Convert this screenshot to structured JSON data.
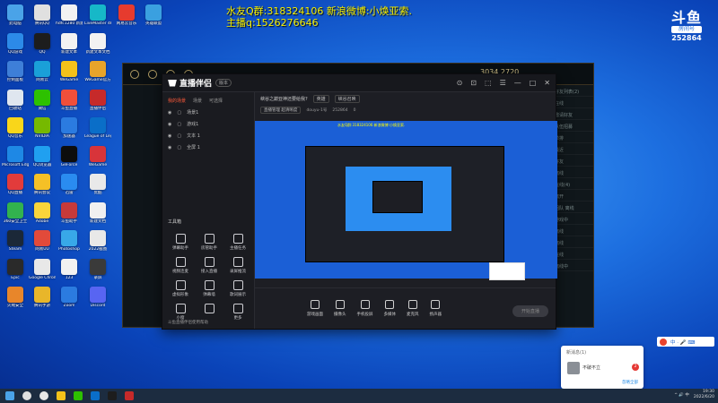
{
  "overlay": {
    "line1": "水友Q群:318324106 新浪微博:小焕亚索.",
    "line2": "主播q:1526276646"
  },
  "douyu": {
    "logo": "斗鱼",
    "sub": "房间号",
    "room": "252864"
  },
  "desktop_icons": [
    {
      "label": "此电脑",
      "color": "#4aa3e8",
      "col": 0,
      "row": 0
    },
    {
      "label": "腾讯QQ",
      "color": "#e0e0e0",
      "col": 1,
      "row": 0
    },
    {
      "label": "hdfc1280 新建文件夹",
      "color": "#f2f2f2",
      "col": 2,
      "row": 0
    },
    {
      "label": "LiveMaster 4K",
      "color": "#16b8c8",
      "col": 3,
      "row": 0
    },
    {
      "label": "网易云音乐",
      "color": "#e63b2e",
      "col": 4,
      "row": 0
    },
    {
      "label": "英雄联盟",
      "color": "#3aa0e0",
      "col": 5,
      "row": 0
    },
    {
      "label": "QQ游戏",
      "color": "#2c8ae8",
      "col": 0,
      "row": 1
    },
    {
      "label": "QQ",
      "color": "#1d1d1d",
      "col": 1,
      "row": 1
    },
    {
      "label": "新建文本",
      "color": "#f2f2f2",
      "col": 2,
      "row": 1
    },
    {
      "label": "新建文本文档",
      "color": "#f2f2f2",
      "col": 3,
      "row": 1
    },
    {
      "label": "控制面板",
      "color": "#3e7fd8",
      "col": 0,
      "row": 2
    },
    {
      "label": "网易云",
      "color": "#1aa0d8",
      "col": 1,
      "row": 2
    },
    {
      "label": "WeGame",
      "color": "#f4c21a",
      "col": 2,
      "row": 2
    },
    {
      "label": "WeGame官方",
      "color": "#e8a42a",
      "col": 3,
      "row": 2
    },
    {
      "label": "回收站",
      "color": "#dfe6ef",
      "col": 0,
      "row": 3
    },
    {
      "label": "微信",
      "color": "#2dc100",
      "col": 1,
      "row": 3
    },
    {
      "label": "斗鱼直播",
      "color": "#f04f3a",
      "col": 2,
      "row": 3
    },
    {
      "label": "直播伴侣",
      "color": "#c62a2a",
      "col": 3,
      "row": 3
    },
    {
      "label": "QQ音乐",
      "color": "#f9d61a",
      "col": 0,
      "row": 4
    },
    {
      "label": "NVIDIA",
      "color": "#76b900",
      "col": 1,
      "row": 4
    },
    {
      "label": "加速器",
      "color": "#2b7be0",
      "col": 2,
      "row": 4
    },
    {
      "label": "League of Legends",
      "color": "#0a6ec8",
      "col": 3,
      "row": 4
    },
    {
      "label": "Microsoft Edge",
      "color": "#1e88e5",
      "col": 0,
      "row": 5
    },
    {
      "label": "QQ浏览器",
      "color": "#20a0f0",
      "col": 1,
      "row": 5
    },
    {
      "label": "GeForce",
      "color": "#0d0d0d",
      "col": 2,
      "row": 5
    },
    {
      "label": "WeGame",
      "color": "#d8343a",
      "col": 3,
      "row": 5
    },
    {
      "label": "QQ直播",
      "color": "#e23b3b",
      "col": 0,
      "row": 6
    },
    {
      "label": "腾讯会议",
      "color": "#f5c026",
      "col": 1,
      "row": 6
    },
    {
      "label": "迅雷",
      "color": "#2a8cf0",
      "col": 2,
      "row": 6
    },
    {
      "label": "优酷",
      "color": "#e9e9e9",
      "col": 3,
      "row": 6
    },
    {
      "label": "360安全卫士",
      "color": "#32b24e",
      "col": 0,
      "row": 7
    },
    {
      "label": "Adobe",
      "color": "#f9d43b",
      "col": 1,
      "row": 7
    },
    {
      "label": "斗鱼助手",
      "color": "#c73a3a",
      "col": 2,
      "row": 7
    },
    {
      "label": "新建文档",
      "color": "#f0f0f0",
      "col": 3,
      "row": 7
    },
    {
      "label": "Steam",
      "color": "#1b2838",
      "col": 0,
      "row": 8
    },
    {
      "label": "网易UU",
      "color": "#e24a3a",
      "col": 1,
      "row": 8
    },
    {
      "label": "Photoshop",
      "color": "#38a8e8",
      "col": 2,
      "row": 8
    },
    {
      "label": "2022截图",
      "color": "#e8e8e8",
      "col": 3,
      "row": 8
    },
    {
      "label": "Epic",
      "color": "#2a2a2a",
      "col": 0,
      "row": 9
    },
    {
      "label": "Google Chrome",
      "color": "#e8e8e8",
      "col": 1,
      "row": 9
    },
    {
      "label": "123",
      "color": "#f1f1f1",
      "col": 2,
      "row": 9
    },
    {
      "label": "录屏",
      "color": "#3a3a3a",
      "col": 3,
      "row": 9
    },
    {
      "label": "火绒安全",
      "color": "#e8862a",
      "col": 0,
      "row": 10
    },
    {
      "label": "腾讯手游",
      "color": "#e8b62a",
      "col": 1,
      "row": 10
    },
    {
      "label": "Zoom",
      "color": "#2b7be0",
      "col": 2,
      "row": 10
    },
    {
      "label": "Discord",
      "color": "#5865f2",
      "col": 3,
      "row": 10
    }
  ],
  "obs": {
    "app_name": "直播伴侣",
    "version": "版本",
    "tabs": [
      "我的场景",
      "场景",
      "可选择"
    ],
    "scenes": [
      "场景1",
      "游戏1",
      "文本 1",
      "全屏 1"
    ],
    "stream_title": "峡谷之巅亚神还要给我?",
    "category": "英雄",
    "category2": "峡谷召唤",
    "quality": "直播管理  超清晰度",
    "id_label": "douyu-1号",
    "room": "252864",
    "fans": "0",
    "tools_title": "工具箱",
    "tools": [
      "弹幕助手",
      "房管助手",
      "主播任务",
      "视频连麦",
      "接入直播",
      "录屏推流",
      "虚拟形象",
      "弹幕墙",
      "歌词展示",
      "小窗",
      "",
      "更多"
    ],
    "notice": "斗鱼直播伴侣使用帮助",
    "bottom_tools": [
      "游戏画面",
      "摄像头",
      "手机投屏",
      "多媒体",
      "麦克风",
      "扬声器"
    ],
    "start_label": "开始直播",
    "window_controls": [
      "⊙",
      "⊡",
      "⬚",
      "☰",
      "—",
      "□",
      "✕"
    ]
  },
  "game": {
    "coins": "3034   2720",
    "side_rows": [
      "好友列表(2)",
      "在线",
      "邀请好友",
      "队伍招募",
      "单排",
      "最近",
      "好友",
      "离线",
      "在线(4)",
      "离开",
      "组队 离线",
      "游戏中",
      "离线",
      "离线",
      "在线",
      "离线中"
    ]
  },
  "notification": {
    "title": "新消息(1)",
    "name": "不破不立",
    "count": "2",
    "link": "忽略全部"
  },
  "ime": {
    "label": "中 ·  🎤 ⌨"
  },
  "taskbar": {
    "time": "19:30",
    "date": "2022/6/20",
    "tray": "^ 🔊 中"
  }
}
